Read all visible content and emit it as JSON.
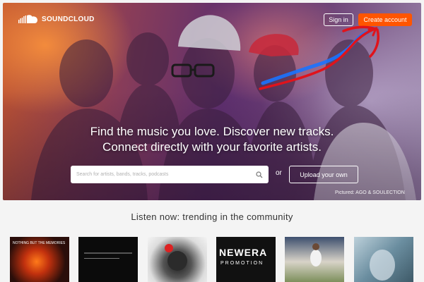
{
  "header": {
    "logo_text": "SOUNDCLOUD",
    "sign_in_label": "Sign in",
    "create_account_label": "Create account"
  },
  "hero": {
    "tagline_line1": "Find the music you love. Discover new tracks.",
    "tagline_line2": "Connect directly with your favorite artists.",
    "search_placeholder": "Search for artists, bands, tracks, podcasts",
    "or_label": "or",
    "upload_label": "Upload your own",
    "credit": "Pictured: AGO & SOULECTION"
  },
  "trending": {
    "title": "Listen now: trending in the community",
    "tiles": [
      {
        "name": "artwork-1",
        "text": "NOTHING BUT THE MEMORIES"
      },
      {
        "name": "artwork-2",
        "text": ""
      },
      {
        "name": "artwork-3",
        "text": ""
      },
      {
        "name": "artwork-4",
        "text": "NEWERA",
        "sub": "PROMOTION"
      },
      {
        "name": "artwork-5",
        "text": ""
      },
      {
        "name": "artwork-6",
        "text": ""
      }
    ]
  },
  "colors": {
    "brand_orange": "#ff5500",
    "annotation_red": "#e0131b",
    "annotation_blue": "#1a73ff"
  },
  "icons": [
    "soundcloud-logo-icon",
    "search-icon"
  ]
}
